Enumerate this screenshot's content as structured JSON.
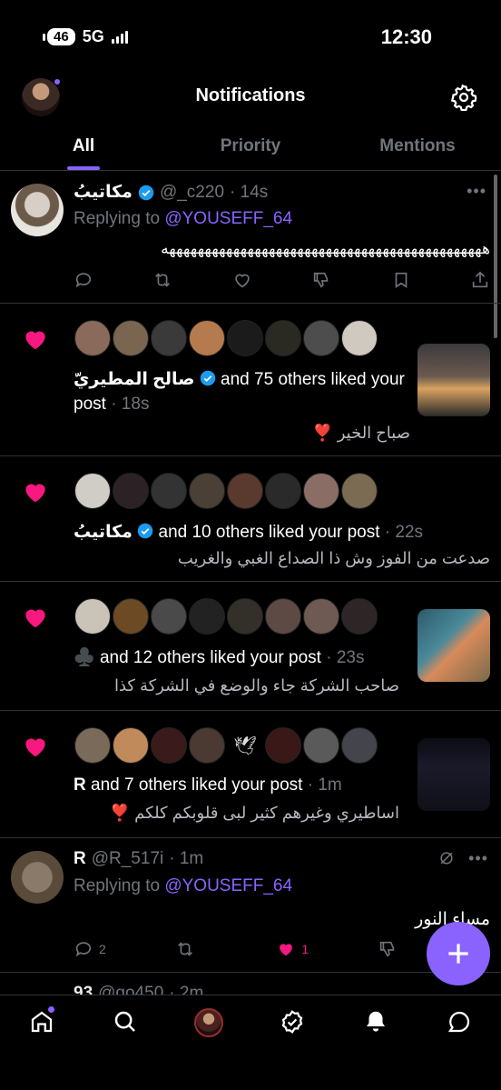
{
  "status": {
    "battery": "46",
    "network": "5G",
    "time": "12:30"
  },
  "header": {
    "title": "Notifications"
  },
  "tabs": [
    {
      "label": "All"
    },
    {
      "label": "Priority"
    },
    {
      "label": "Mentions"
    }
  ],
  "reply1": {
    "name": "مكاتيبُ",
    "handle": "@_c220",
    "time": "· 14s",
    "replying_prefix": "Replying to",
    "replying_handle": "@YOUSEFF_64",
    "body": "هههههههههههههههههههههههههههههههههههههههههههههه"
  },
  "like1": {
    "name": "صالح المطيريّ",
    "text": "and 75 others liked your post",
    "time": "· 18s",
    "post": "صباح الخير ❣️"
  },
  "like2": {
    "name": "مكاتيبُ",
    "text": "and 10 others liked your post",
    "time": "· 22s",
    "post": "صدعت من الفوز وش ذا الصداع الغبي والغريب"
  },
  "like3": {
    "name": "♣️",
    "text": "and 12 others liked your post",
    "time": "· 23s",
    "post": "صاحب الشركة جاء والوضع في الشركة كذا"
  },
  "like4": {
    "name": "R",
    "text": "and 7 others liked your post",
    "time": "· 1m",
    "post": "اساطيري وغيرهم كثير لبى قلوبكم كلكم ❣️"
  },
  "reply2": {
    "name": "R",
    "handle": "@R_517i",
    "time": "· 1m",
    "replying_prefix": "Replying to",
    "replying_handle": "@YOUSEFF_64",
    "body": "مساء النور",
    "reply_count": "2",
    "like_count": "1"
  },
  "peek": {
    "name": "93",
    "handle": "@go450",
    "time": "· 2m"
  },
  "colors": {
    "accent": "#8a63ff",
    "like": "#f91880",
    "verified": "#1d9bf0"
  }
}
